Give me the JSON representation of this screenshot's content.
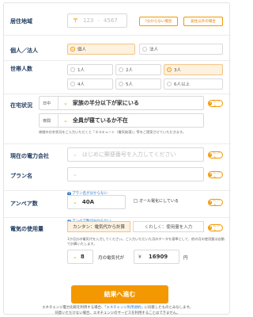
{
  "postal": {
    "label": "居住地域",
    "mark": "〒",
    "part1_placeholder": "123",
    "part2_placeholder": "4567",
    "btn_unknown": "?分からない場合",
    "btn_outside": "居住以外の場合"
  },
  "applicant": {
    "label": "個人／法人",
    "options": [
      "個人",
      "法人"
    ],
    "selected": "個人"
  },
  "household": {
    "label": "世帯人数",
    "options": [
      "1人",
      "2人",
      "3人",
      "4人",
      "5人",
      "6人以上"
    ],
    "selected": "3人"
  },
  "home": {
    "label": "在宅状況",
    "day_label": "日中",
    "day_value": "家族の半分以下が家にいる",
    "night_label": "夜間",
    "night_value": "全員が寝ているか不在",
    "hint": "ヒント",
    "note": "夜間の在宅状況をご入力いただくと「エコキュート（電気給湯）」等をご提案させていただきます。"
  },
  "company": {
    "label": "現在の電力会社",
    "placeholder": "はじめに郵便番号を入力してください",
    "hint": "ヒント"
  },
  "plan": {
    "label": "プラン名",
    "link": "プラン名が分からない",
    "hint": "ヒント"
  },
  "ampere": {
    "label": "アンペア数",
    "value": "40A",
    "all_electric": "オール電化にしている",
    "link": "アンペア数が分からない",
    "hint": "ヒント"
  },
  "usage": {
    "label": "電気の使用量",
    "tabs": [
      "カンタン：電気代から計算",
      "くわしく：使用量を入力"
    ],
    "note": "1か月分の電気代を入力してください。ご入力いただいた月のデータを基準として、他の月の使用量は自動で計算いたします。",
    "month": "8",
    "month_suffix": "月の電気代が",
    "yen_mark": "¥",
    "amount": "16909",
    "yen_suffix": "円",
    "hint": "ヒント"
  },
  "submit_label": "結果へ進む",
  "footer": {
    "line1_pre": "エネチェンジ電力比較を利用する場合、「",
    "line1_link": "エネチェンジ利用規約",
    "line1_post": "」に同意したものとみなします。",
    "line2": "同意いただけない場合、エネチェンジのサービスを利用することはできません。"
  },
  "colors": {
    "accent": "#f39800",
    "label": "#1f3a5f",
    "link": "#2d79c7"
  }
}
